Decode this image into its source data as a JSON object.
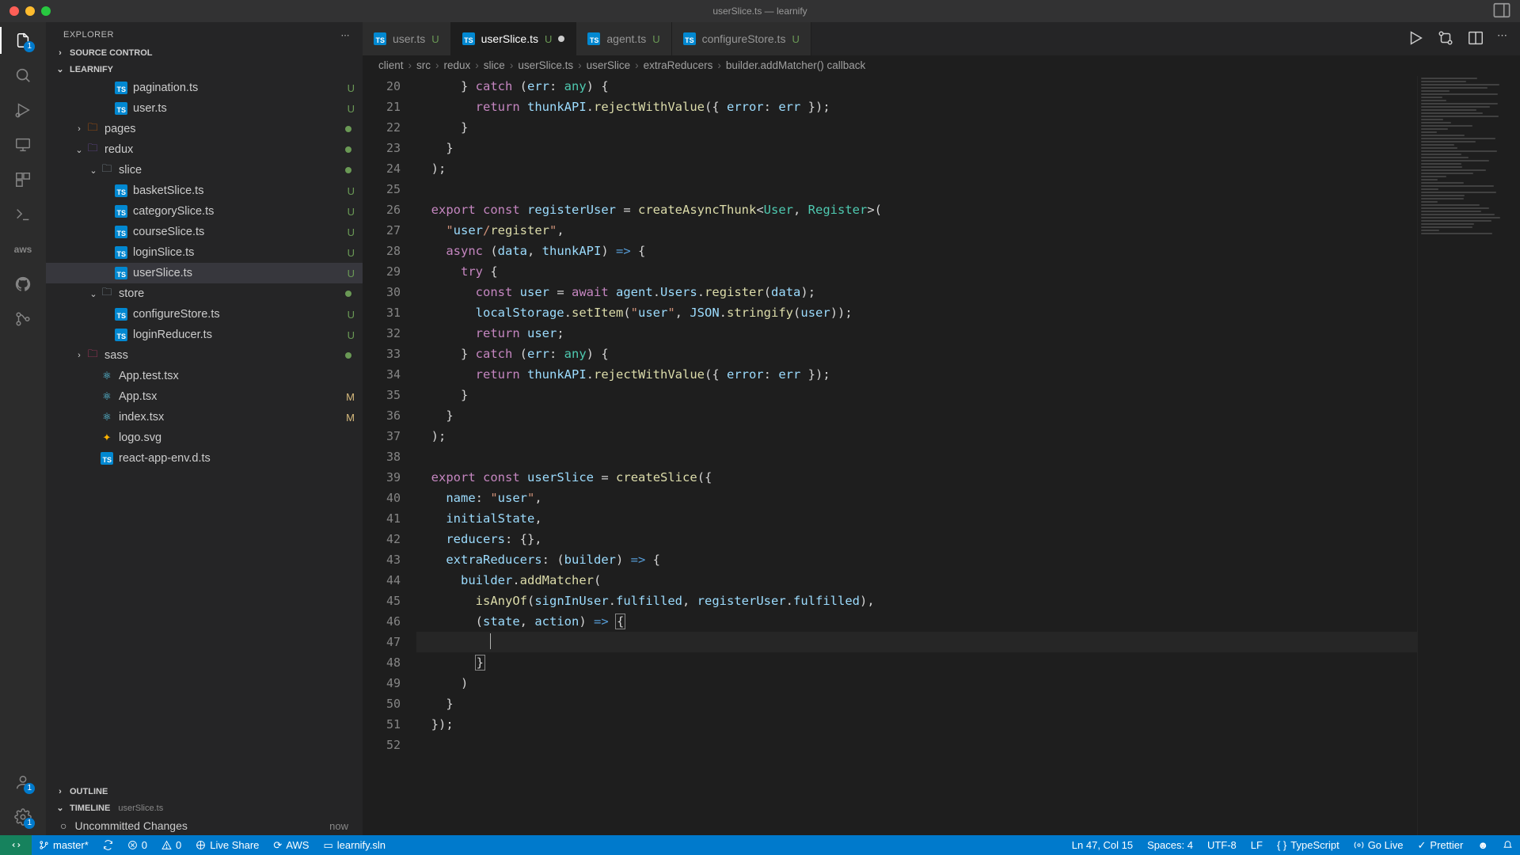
{
  "title": "userSlice.ts — learnify",
  "explorer": {
    "header": "EXPLORER",
    "sections": {
      "sourceControl": "SOURCE CONTROL",
      "project": "LEARNIFY",
      "outline": "OUTLINE",
      "timeline": "TIMELINE",
      "timelineFile": "userSlice.ts"
    },
    "tree": [
      {
        "indent": 3,
        "icon": "ts",
        "label": "pagination.ts",
        "status": "U"
      },
      {
        "indent": 3,
        "icon": "ts",
        "label": "user.ts",
        "status": "U"
      },
      {
        "indent": 1,
        "chev": "›",
        "icon": "folder-pages",
        "label": "pages",
        "dot": true
      },
      {
        "indent": 1,
        "chev": "⌄",
        "icon": "folder-redux",
        "label": "redux",
        "dot": true
      },
      {
        "indent": 2,
        "chev": "⌄",
        "icon": "folder",
        "label": "slice",
        "dot": true
      },
      {
        "indent": 3,
        "icon": "ts",
        "label": "basketSlice.ts",
        "status": "U"
      },
      {
        "indent": 3,
        "icon": "ts",
        "label": "categorySlice.ts",
        "status": "U"
      },
      {
        "indent": 3,
        "icon": "ts",
        "label": "courseSlice.ts",
        "status": "U"
      },
      {
        "indent": 3,
        "icon": "ts",
        "label": "loginSlice.ts",
        "status": "U"
      },
      {
        "indent": 3,
        "icon": "ts",
        "label": "userSlice.ts",
        "status": "U",
        "selected": true
      },
      {
        "indent": 2,
        "chev": "⌄",
        "icon": "folder",
        "label": "store",
        "dot": true
      },
      {
        "indent": 3,
        "icon": "ts",
        "label": "configureStore.ts",
        "status": "U"
      },
      {
        "indent": 3,
        "icon": "ts",
        "label": "loginReducer.ts",
        "status": "U"
      },
      {
        "indent": 1,
        "chev": "›",
        "icon": "folder-sass",
        "label": "sass",
        "dot": true
      },
      {
        "indent": 2,
        "icon": "react",
        "label": "App.test.tsx"
      },
      {
        "indent": 2,
        "icon": "react",
        "label": "App.tsx",
        "status": "M"
      },
      {
        "indent": 2,
        "icon": "react",
        "label": "index.tsx",
        "status": "M"
      },
      {
        "indent": 2,
        "icon": "svg",
        "label": "logo.svg"
      },
      {
        "indent": 2,
        "icon": "ts",
        "label": "react-app-env.d.ts"
      }
    ],
    "timeline": {
      "row": "Uncommitted Changes",
      "when": "now"
    }
  },
  "tabs": [
    {
      "label": "user.ts",
      "status": "U"
    },
    {
      "label": "userSlice.ts",
      "status": "U",
      "active": true,
      "dirty": true
    },
    {
      "label": "agent.ts",
      "status": "U"
    },
    {
      "label": "configureStore.ts",
      "status": "U"
    }
  ],
  "breadcrumb": [
    "client",
    "src",
    "redux",
    "slice",
    "userSlice.ts",
    "userSlice",
    "extraReducers",
    "builder.addMatcher() callback"
  ],
  "code": {
    "start": 20,
    "lines": [
      "      } catch (err: any) {",
      "        return thunkAPI.rejectWithValue({ error: err });",
      "      }",
      "    }",
      "  );",
      "",
      "  export const registerUser = createAsyncThunk<User, Register>(",
      "    \"user/register\",",
      "    async (data, thunkAPI) => {",
      "      try {",
      "        const user = await agent.Users.register(data);",
      "        localStorage.setItem(\"user\", JSON.stringify(user));",
      "        return user;",
      "      } catch (err: any) {",
      "        return thunkAPI.rejectWithValue({ error: err });",
      "      }",
      "    }",
      "  );",
      "",
      "  export const userSlice = createSlice({",
      "    name: \"user\",",
      "    initialState,",
      "    reducers: {},",
      "    extraReducers: (builder) => {",
      "      builder.addMatcher(",
      "        isAnyOf(signInUser.fulfilled, registerUser.fulfilled),",
      "        (state, action) => {",
      "          ",
      "        }",
      "      )",
      "    }",
      "  });",
      ""
    ]
  },
  "statusbar": {
    "branch": "master*",
    "errors": "0",
    "warnings": "0",
    "liveShare": "Live Share",
    "aws": "AWS",
    "solution": "learnify.sln",
    "position": "Ln 47, Col 15",
    "spaces": "Spaces: 4",
    "encoding": "UTF-8",
    "eol": "LF",
    "lang": "TypeScript",
    "goLive": "Go Live",
    "prettier": "Prettier"
  }
}
